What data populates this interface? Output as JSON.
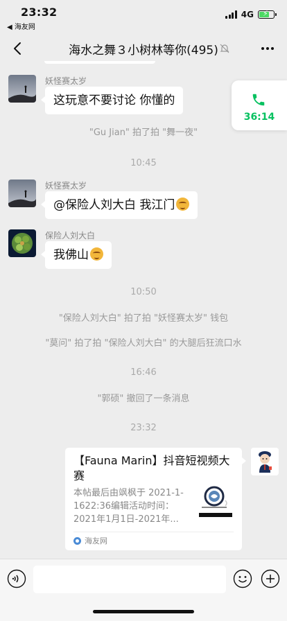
{
  "status_bar": {
    "time": "23:32",
    "back_app": "◀ 海友网",
    "network": "4G",
    "battery_level": 0.75
  },
  "header": {
    "title": "海水之舞３小树林等你(495)"
  },
  "messages": [
    {
      "sender": "妖怪赛太岁",
      "text": "这玩意不要讨论  你懂的"
    },
    {
      "sender": "妖怪赛太岁",
      "text": "@保险人刘大白 我江门"
    },
    {
      "sender": "保险人刘大白",
      "text": "我佛山"
    }
  ],
  "system_lines": {
    "pat_1": "\"Gu Jian\" 拍了拍 \"舞一夜\"",
    "pat_2": "\"保险人刘大白\" 拍了拍 \"妖怪赛太岁\" 钱包",
    "pat_3": "\"莫问\" 拍了拍 \"保险人刘大白\" 的大腿后狂流口水",
    "recall": "\"郭硕\" 撤回了一条消息"
  },
  "timestamps": [
    "10:45",
    "10:50",
    "16:46",
    "23:32"
  ],
  "call": {
    "duration": "36:14"
  },
  "link_card": {
    "title": "【Fauna Marin】抖音短视频大赛",
    "description": "本帖最后由飒枫于 2021-1-1622:36编辑活动时间：2021年1月1日-2021年...",
    "source": "海友网"
  },
  "input": {
    "placeholder": ""
  },
  "colors": {
    "accent": "#07c160",
    "background": "#ededed"
  },
  "icons": [
    "back-icon",
    "mute-icon",
    "more-icon",
    "phone-icon",
    "voice-icon",
    "emoji-icon",
    "plus-icon"
  ]
}
